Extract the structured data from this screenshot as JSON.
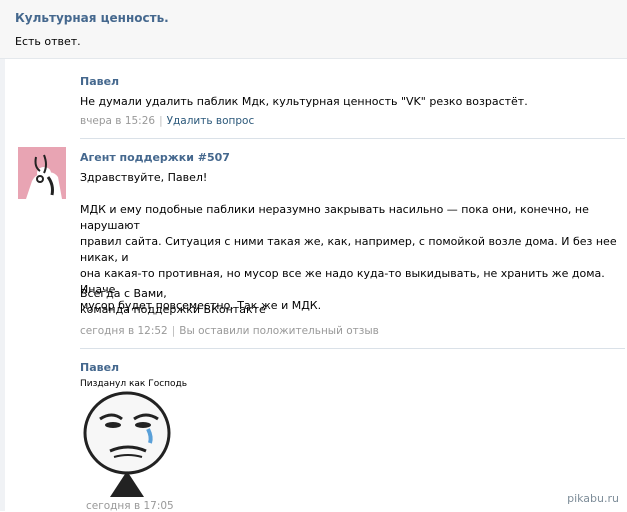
{
  "header": {
    "title": "Культурная ценность.",
    "subtitle": "Есть ответ."
  },
  "question": {
    "author": "Павел",
    "text": "Не думали удалить паблик Мдк, культурная ценность \"VK\" резко возрастёт.",
    "timestamp": "вчера в 15:26",
    "action": "Удалить вопрос"
  },
  "answer": {
    "author": "Агент поддержки #507",
    "greeting": "Здравствуйте, Павел!",
    "body": "МДК и ему подобные паблики неразумно закрывать насильно — пока они, конечно, не нарушают\nправил сайта. Ситуация с ними такая же, как, например, с помойкой возле дома. И без нее никак, и\nона какая-то противная, но мусор все же надо куда-то выкидывать, не хранить же дома. Иначе\nмусор будет повсеместно. Так же и МДК.",
    "signoff": "Всегда с Вами,\nкоманда поддержки ВКонтакте",
    "timestamp": "сегодня в 12:52",
    "rating": "Вы оставили положительный отзыв"
  },
  "reply": {
    "author": "Павел",
    "text": "Пизданул как Господь",
    "timestamp": "сегодня в 17:05"
  },
  "watermark": "pikabu.ru",
  "colors": {
    "link": "#45688e",
    "meta": "#999999",
    "divider": "#dae1e8",
    "avatar_bg": "#e8a4b3"
  }
}
